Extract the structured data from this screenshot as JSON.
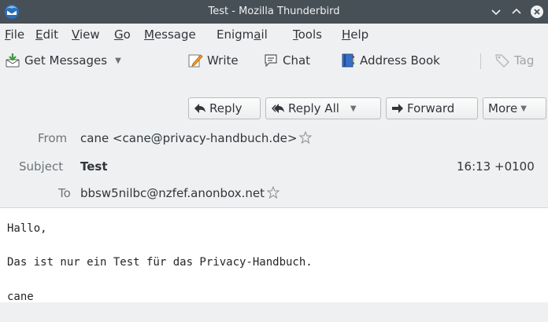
{
  "window": {
    "title": "Test - Mozilla Thunderbird",
    "app_icon": "thunderbird-icon"
  },
  "menubar": {
    "items": [
      {
        "mnemonic": "F",
        "rest": "ile"
      },
      {
        "mnemonic": "E",
        "rest": "dit"
      },
      {
        "mnemonic": "V",
        "rest": "iew"
      },
      {
        "mnemonic": "G",
        "rest": "o"
      },
      {
        "mnemonic": "M",
        "rest": "essage"
      },
      {
        "pre": "Enigm",
        "mnemonic": "a",
        "rest": "il"
      },
      {
        "mnemonic": "T",
        "rest": "ools"
      },
      {
        "mnemonic": "H",
        "rest": "elp"
      }
    ]
  },
  "toolbar": {
    "get_messages": "Get Messages",
    "write": "Write",
    "chat": "Chat",
    "address_book": "Address Book",
    "tag": "Tag"
  },
  "actions": {
    "reply": "Reply",
    "reply_all": "Reply All",
    "forward": "Forward",
    "more": "More"
  },
  "header": {
    "from_label": "From",
    "from_value": "cane <cane@privacy-handbuch.de>",
    "subject_label": "Subject",
    "subject_value": "Test",
    "date": "16:13 +0100",
    "to_label": "To",
    "to_value": "bbsw5nilbc@nzfef.anonbox.net"
  },
  "body": {
    "lines": [
      "Hallo,",
      "Das ist nur ein Test für das Privacy-Handbuch.",
      "cane"
    ]
  },
  "colors": {
    "titlebar": "#475057",
    "chrome": "#eff0f1",
    "text": "#31363b",
    "close_button": "#da4453"
  }
}
